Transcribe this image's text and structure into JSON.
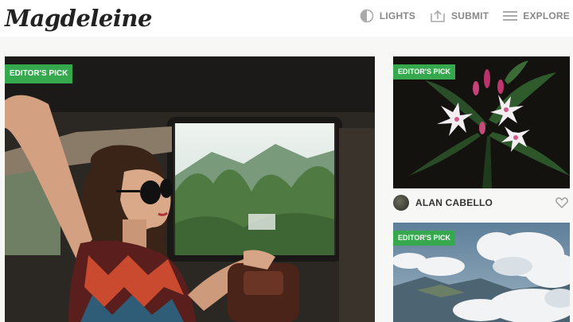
{
  "site": {
    "logo": "Magdeleine"
  },
  "nav": [
    {
      "label": "LIGHTS",
      "icon": "lightbulb-icon"
    },
    {
      "label": "SUBMIT",
      "icon": "upload-icon"
    },
    {
      "label": "EXPLORE",
      "icon": "menu-icon"
    }
  ],
  "cards": [
    {
      "badge": "EDITOR'S PICK",
      "subject": "woman in car with sunglasses"
    },
    {
      "badge": "EDITOR'S PICK",
      "subject": "white flowers",
      "author": "ALAN CABELLO",
      "like_icon": "heart-icon"
    },
    {
      "badge": "EDITOR'S PICK",
      "subject": "clouds over mountains"
    }
  ],
  "colors": {
    "accent": "#36a94e",
    "header_bg": "#ffffff",
    "page_bg": "#f7f7f5"
  }
}
